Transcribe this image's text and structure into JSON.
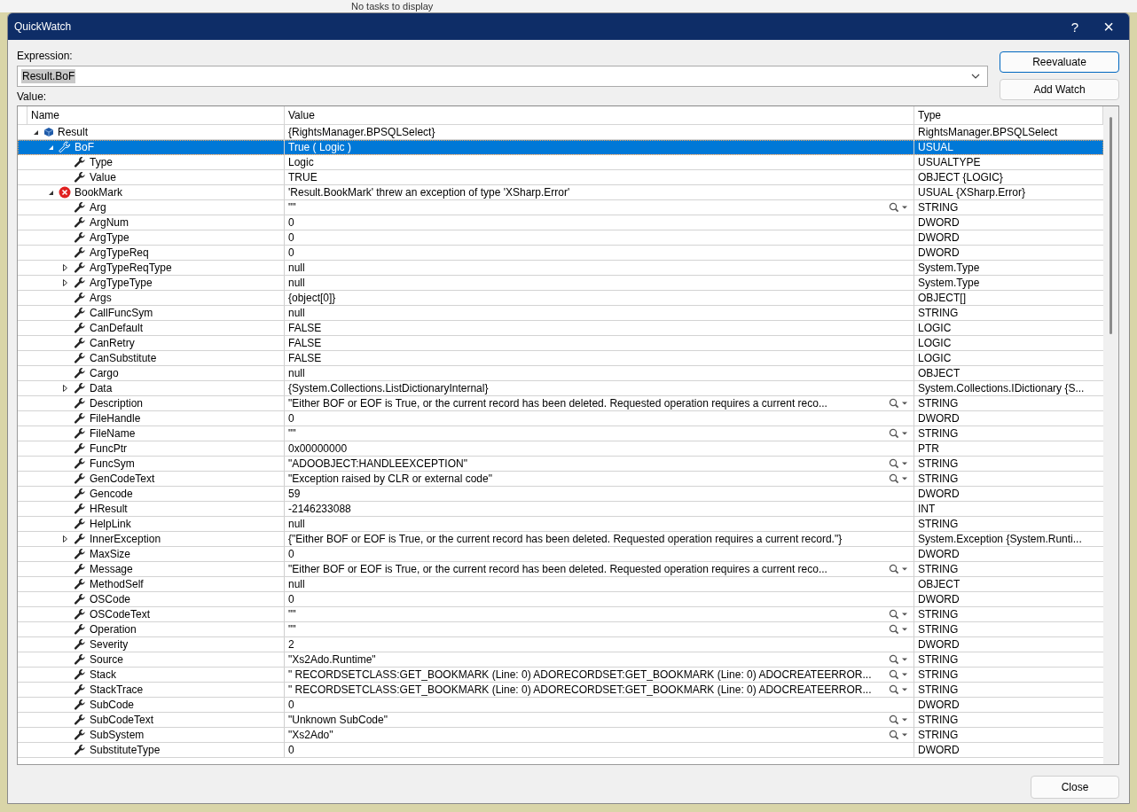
{
  "background_text": "No tasks to display",
  "window": {
    "title": "QuickWatch",
    "help": "?",
    "close": "×"
  },
  "expression": {
    "label": "Expression:",
    "value": "Result.BoF",
    "value_selected": true
  },
  "buttons": [
    {
      "label": "Reevaluate",
      "default": true
    },
    {
      "label": "Add Watch",
      "default": false
    }
  ],
  "value_label": "Value:",
  "columns": [
    "Name",
    "Value",
    "Type"
  ],
  "rows": [
    {
      "name": "Result",
      "value": "{RightsManager.BPSQLSelect}",
      "type": "RightsManager.BPSQLSelect",
      "kind": "object",
      "expanded": true,
      "viewer": false,
      "selected": false,
      "children": [
        {
          "name": "BoF",
          "value": "True ( Logic )",
          "type": "USUAL",
          "kind": "property",
          "expanded": true,
          "viewer": false,
          "selected": true,
          "children": [
            {
              "name": "Type",
              "value": "Logic",
              "type": "USUALTYPE",
              "kind": "property",
              "viewer": false,
              "selected": false
            },
            {
              "name": "Value",
              "value": "TRUE",
              "type": "OBJECT {LOGIC}",
              "kind": "property",
              "viewer": false,
              "selected": false
            }
          ]
        },
        {
          "name": "BookMark",
          "value": "'Result.BookMark' threw an exception of type 'XSharp.Error'",
          "type": "USUAL {XSharp.Error}",
          "kind": "error",
          "expanded": true,
          "viewer": false,
          "selected": false,
          "children": [
            {
              "name": "Arg",
              "value": "\"\"",
              "type": "STRING",
              "kind": "property",
              "viewer": true,
              "selected": false
            },
            {
              "name": "ArgNum",
              "value": "0",
              "type": "DWORD",
              "kind": "property",
              "viewer": false,
              "selected": false
            },
            {
              "name": "ArgType",
              "value": "0",
              "type": "DWORD",
              "kind": "property",
              "viewer": false,
              "selected": false
            },
            {
              "name": "ArgTypeReq",
              "value": "0",
              "type": "DWORD",
              "kind": "property",
              "viewer": false,
              "selected": false
            },
            {
              "name": "ArgTypeReqType",
              "value": "null",
              "type": "System.Type",
              "kind": "property",
              "expanded": false,
              "viewer": false,
              "selected": false
            },
            {
              "name": "ArgTypeType",
              "value": "null",
              "type": "System.Type",
              "kind": "property",
              "expanded": false,
              "viewer": false,
              "selected": false
            },
            {
              "name": "Args",
              "value": "{object[0]}",
              "type": "OBJECT[]",
              "kind": "property",
              "viewer": false,
              "selected": false
            },
            {
              "name": "CallFuncSym",
              "value": "null",
              "type": "STRING",
              "kind": "property",
              "viewer": false,
              "selected": false
            },
            {
              "name": "CanDefault",
              "value": "FALSE",
              "type": "LOGIC",
              "kind": "property",
              "viewer": false,
              "selected": false
            },
            {
              "name": "CanRetry",
              "value": "FALSE",
              "type": "LOGIC",
              "kind": "property",
              "viewer": false,
              "selected": false
            },
            {
              "name": "CanSubstitute",
              "value": "FALSE",
              "type": "LOGIC",
              "kind": "property",
              "viewer": false,
              "selected": false
            },
            {
              "name": "Cargo",
              "value": "null",
              "type": "OBJECT",
              "kind": "property",
              "viewer": false,
              "selected": false
            },
            {
              "name": "Data",
              "value": "{System.Collections.ListDictionaryInternal}",
              "type": "System.Collections.IDictionary {S...",
              "kind": "property",
              "expanded": false,
              "viewer": false,
              "selected": false
            },
            {
              "name": "Description",
              "value": "\"Either BOF or EOF is True, or the current record has been deleted. Requested operation requires a current reco...",
              "type": "STRING",
              "kind": "property",
              "viewer": true,
              "selected": false
            },
            {
              "name": "FileHandle",
              "value": "0",
              "type": "DWORD",
              "kind": "property",
              "viewer": false,
              "selected": false
            },
            {
              "name": "FileName",
              "value": "\"\"",
              "type": "STRING",
              "kind": "property",
              "viewer": true,
              "selected": false
            },
            {
              "name": "FuncPtr",
              "value": "0x00000000",
              "type": "PTR",
              "kind": "property",
              "viewer": false,
              "selected": false
            },
            {
              "name": "FuncSym",
              "value": "\"ADOOBJECT:HANDLEEXCEPTION\"",
              "type": "STRING",
              "kind": "property",
              "viewer": true,
              "selected": false
            },
            {
              "name": "GenCodeText",
              "value": "\"Exception raised by CLR or external code\"",
              "type": "STRING",
              "kind": "property",
              "viewer": true,
              "selected": false
            },
            {
              "name": "Gencode",
              "value": "59",
              "type": "DWORD",
              "kind": "property",
              "viewer": false,
              "selected": false
            },
            {
              "name": "HResult",
              "value": "-2146233088",
              "type": "INT",
              "kind": "property",
              "viewer": false,
              "selected": false
            },
            {
              "name": "HelpLink",
              "value": "null",
              "type": "STRING",
              "kind": "property",
              "viewer": false,
              "selected": false
            },
            {
              "name": "InnerException",
              "value": "{\"Either BOF or EOF is True, or the current record has been deleted. Requested operation requires a current record.\"}",
              "type": "System.Exception {System.Runti...",
              "kind": "property",
              "expanded": false,
              "viewer": false,
              "selected": false
            },
            {
              "name": "MaxSize",
              "value": "0",
              "type": "DWORD",
              "kind": "property",
              "viewer": false,
              "selected": false
            },
            {
              "name": "Message",
              "value": "\"Either BOF or EOF is True, or the current record has been deleted. Requested operation requires a current reco...",
              "type": "STRING",
              "kind": "property",
              "viewer": true,
              "selected": false
            },
            {
              "name": "MethodSelf",
              "value": "null",
              "type": "OBJECT",
              "kind": "property",
              "viewer": false,
              "selected": false
            },
            {
              "name": "OSCode",
              "value": "0",
              "type": "DWORD",
              "kind": "property",
              "viewer": false,
              "selected": false
            },
            {
              "name": "OSCodeText",
              "value": "\"\"",
              "type": "STRING",
              "kind": "property",
              "viewer": true,
              "selected": false
            },
            {
              "name": "Operation",
              "value": "\"\"",
              "type": "STRING",
              "kind": "property",
              "viewer": true,
              "selected": false
            },
            {
              "name": "Severity",
              "value": "2",
              "type": "DWORD",
              "kind": "property",
              "viewer": false,
              "selected": false
            },
            {
              "name": "Source",
              "value": "\"Xs2Ado.Runtime\"",
              "type": "STRING",
              "kind": "property",
              "viewer": true,
              "selected": false
            },
            {
              "name": "Stack",
              "value": "\" RECORDSETCLASS:GET_BOOKMARK (Line: 0)  ADORECORDSET:GET_BOOKMARK (Line: 0)  ADOCREATEERROR...",
              "type": "STRING",
              "kind": "property",
              "viewer": true,
              "selected": false
            },
            {
              "name": "StackTrace",
              "value": "\" RECORDSETCLASS:GET_BOOKMARK (Line: 0)  ADORECORDSET:GET_BOOKMARK (Line: 0)  ADOCREATEERROR...",
              "type": "STRING",
              "kind": "property",
              "viewer": true,
              "selected": false
            },
            {
              "name": "SubCode",
              "value": "0",
              "type": "DWORD",
              "kind": "property",
              "viewer": false,
              "selected": false
            },
            {
              "name": "SubCodeText",
              "value": "\"Unknown SubCode\"",
              "type": "STRING",
              "kind": "property",
              "viewer": true,
              "selected": false
            },
            {
              "name": "SubSystem",
              "value": "\"Xs2Ado\"",
              "type": "STRING",
              "kind": "property",
              "viewer": true,
              "selected": false
            },
            {
              "name": "SubstituteType",
              "value": "0",
              "type": "DWORD",
              "kind": "property",
              "viewer": false,
              "selected": false
            }
          ]
        }
      ]
    }
  ],
  "close_button": "Close"
}
